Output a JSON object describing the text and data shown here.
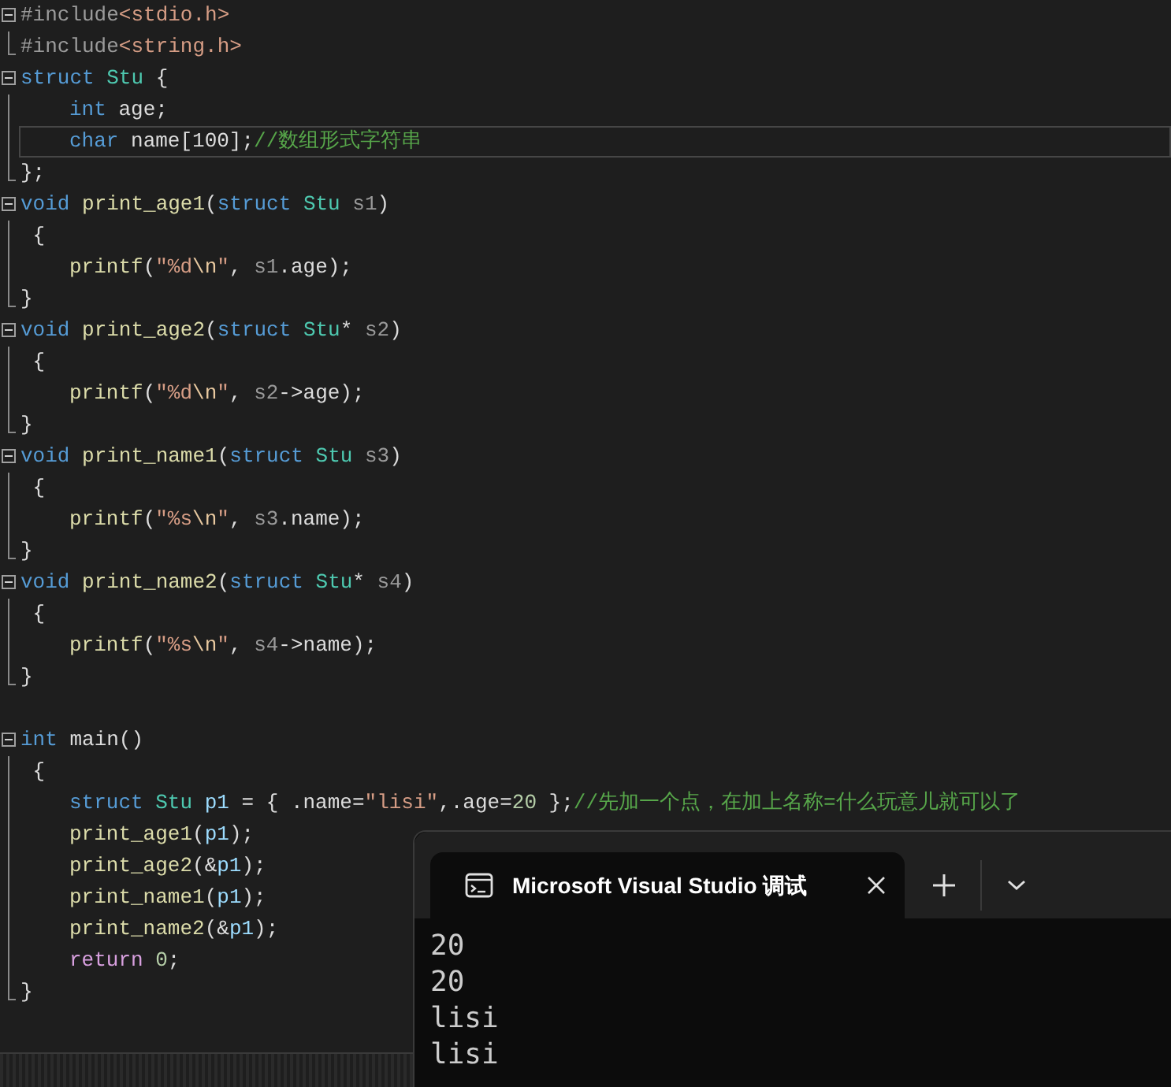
{
  "editor": {
    "items": [
      {
        "kind": "block",
        "expanded": true,
        "lines": [
          {
            "indented": false,
            "current": false,
            "tokens": [
              {
                "kind": "pre",
                "text": "#include"
              },
              {
                "kind": "str",
                "text": "<stdio.h>"
              }
            ]
          },
          {
            "indented": false,
            "current": false,
            "tokens": [
              {
                "kind": "pre",
                "text": "#include"
              },
              {
                "kind": "str",
                "text": "<string.h>"
              }
            ]
          }
        ]
      },
      {
        "kind": "block",
        "expanded": true,
        "lines": [
          {
            "indented": false,
            "current": false,
            "tokens": [
              {
                "kind": "kw",
                "text": "struct "
              },
              {
                "kind": "type",
                "text": "Stu"
              },
              {
                "kind": "txt",
                "text": " {"
              }
            ]
          },
          {
            "indented": true,
            "current": false,
            "tokens": [
              {
                "kind": "kw",
                "text": "int "
              },
              {
                "kind": "txt",
                "text": "age;"
              }
            ]
          },
          {
            "indented": true,
            "current": true,
            "tokens": [
              {
                "kind": "kw",
                "text": "char "
              },
              {
                "kind": "txt",
                "text": "name[100];"
              },
              {
                "kind": "cmt",
                "text": "//数组形式字符串"
              }
            ]
          },
          {
            "indented": false,
            "current": false,
            "tokens": [
              {
                "kind": "txt",
                "text": "};"
              }
            ]
          }
        ]
      },
      {
        "kind": "block",
        "expanded": true,
        "lines": [
          {
            "indented": false,
            "current": false,
            "tokens": [
              {
                "kind": "kw",
                "text": "void "
              },
              {
                "kind": "fn",
                "text": "print_age1"
              },
              {
                "kind": "txt",
                "text": "("
              },
              {
                "kind": "kw",
                "text": "struct "
              },
              {
                "kind": "type",
                "text": "Stu "
              },
              {
                "kind": "par",
                "text": "s1"
              },
              {
                "kind": "txt",
                "text": ")"
              }
            ]
          },
          {
            "indented": false,
            "current": false,
            "tokens": [
              {
                "kind": "txt",
                "text": " {"
              }
            ]
          },
          {
            "indented": true,
            "current": false,
            "tokens": [
              {
                "kind": "fn",
                "text": "printf"
              },
              {
                "kind": "txt",
                "text": "("
              },
              {
                "kind": "str",
                "text": "\"%d"
              },
              {
                "kind": "esc",
                "text": "\\n"
              },
              {
                "kind": "str",
                "text": "\""
              },
              {
                "kind": "txt",
                "text": ", "
              },
              {
                "kind": "par",
                "text": "s1"
              },
              {
                "kind": "txt",
                "text": ".age);"
              }
            ]
          },
          {
            "indented": false,
            "current": false,
            "tokens": [
              {
                "kind": "txt",
                "text": "}"
              }
            ]
          }
        ]
      },
      {
        "kind": "block",
        "expanded": true,
        "lines": [
          {
            "indented": false,
            "current": false,
            "tokens": [
              {
                "kind": "kw",
                "text": "void "
              },
              {
                "kind": "fn",
                "text": "print_age2"
              },
              {
                "kind": "txt",
                "text": "("
              },
              {
                "kind": "kw",
                "text": "struct "
              },
              {
                "kind": "type",
                "text": "Stu"
              },
              {
                "kind": "txt",
                "text": "* "
              },
              {
                "kind": "par",
                "text": "s2"
              },
              {
                "kind": "txt",
                "text": ")"
              }
            ]
          },
          {
            "indented": false,
            "current": false,
            "tokens": [
              {
                "kind": "txt",
                "text": " {"
              }
            ]
          },
          {
            "indented": true,
            "current": false,
            "tokens": [
              {
                "kind": "fn",
                "text": "printf"
              },
              {
                "kind": "txt",
                "text": "("
              },
              {
                "kind": "str",
                "text": "\"%d"
              },
              {
                "kind": "esc",
                "text": "\\n"
              },
              {
                "kind": "str",
                "text": "\""
              },
              {
                "kind": "txt",
                "text": ", "
              },
              {
                "kind": "par",
                "text": "s2"
              },
              {
                "kind": "txt",
                "text": "->age);"
              }
            ]
          },
          {
            "indented": false,
            "current": false,
            "tokens": [
              {
                "kind": "txt",
                "text": "}"
              }
            ]
          }
        ]
      },
      {
        "kind": "block",
        "expanded": true,
        "lines": [
          {
            "indented": false,
            "current": false,
            "tokens": [
              {
                "kind": "kw",
                "text": "void "
              },
              {
                "kind": "fn",
                "text": "print_name1"
              },
              {
                "kind": "txt",
                "text": "("
              },
              {
                "kind": "kw",
                "text": "struct "
              },
              {
                "kind": "type",
                "text": "Stu "
              },
              {
                "kind": "par",
                "text": "s3"
              },
              {
                "kind": "txt",
                "text": ")"
              }
            ]
          },
          {
            "indented": false,
            "current": false,
            "tokens": [
              {
                "kind": "txt",
                "text": " {"
              }
            ]
          },
          {
            "indented": true,
            "current": false,
            "tokens": [
              {
                "kind": "fn",
                "text": "printf"
              },
              {
                "kind": "txt",
                "text": "("
              },
              {
                "kind": "str",
                "text": "\"%s"
              },
              {
                "kind": "esc",
                "text": "\\n"
              },
              {
                "kind": "str",
                "text": "\""
              },
              {
                "kind": "txt",
                "text": ", "
              },
              {
                "kind": "par",
                "text": "s3"
              },
              {
                "kind": "txt",
                "text": ".name);"
              }
            ]
          },
          {
            "indented": false,
            "current": false,
            "tokens": [
              {
                "kind": "txt",
                "text": "}"
              }
            ]
          }
        ]
      },
      {
        "kind": "block",
        "expanded": true,
        "lines": [
          {
            "indented": false,
            "current": false,
            "tokens": [
              {
                "kind": "kw",
                "text": "void "
              },
              {
                "kind": "fn",
                "text": "print_name2"
              },
              {
                "kind": "txt",
                "text": "("
              },
              {
                "kind": "kw",
                "text": "struct "
              },
              {
                "kind": "type",
                "text": "Stu"
              },
              {
                "kind": "txt",
                "text": "* "
              },
              {
                "kind": "par",
                "text": "s4"
              },
              {
                "kind": "txt",
                "text": ")"
              }
            ]
          },
          {
            "indented": false,
            "current": false,
            "tokens": [
              {
                "kind": "txt",
                "text": " {"
              }
            ]
          },
          {
            "indented": true,
            "current": false,
            "tokens": [
              {
                "kind": "fn",
                "text": "printf"
              },
              {
                "kind": "txt",
                "text": "("
              },
              {
                "kind": "str",
                "text": "\"%s"
              },
              {
                "kind": "esc",
                "text": "\\n"
              },
              {
                "kind": "str",
                "text": "\""
              },
              {
                "kind": "txt",
                "text": ", "
              },
              {
                "kind": "par",
                "text": "s4"
              },
              {
                "kind": "txt",
                "text": "->name);"
              }
            ]
          },
          {
            "indented": false,
            "current": false,
            "tokens": [
              {
                "kind": "txt",
                "text": "}"
              }
            ]
          }
        ]
      },
      {
        "kind": "blank"
      },
      {
        "kind": "block",
        "expanded": true,
        "lines": [
          {
            "indented": false,
            "current": false,
            "tokens": [
              {
                "kind": "kw",
                "text": "int "
              },
              {
                "kind": "txt",
                "text": "main()"
              }
            ]
          },
          {
            "indented": false,
            "current": false,
            "tokens": [
              {
                "kind": "txt",
                "text": " {"
              }
            ]
          },
          {
            "indented": true,
            "current": false,
            "tokens": [
              {
                "kind": "kw",
                "text": "struct "
              },
              {
                "kind": "type",
                "text": "Stu "
              },
              {
                "kind": "var",
                "text": "p1"
              },
              {
                "kind": "txt",
                "text": " = { .name="
              },
              {
                "kind": "str",
                "text": "\"lisi\""
              },
              {
                "kind": "txt",
                "text": ",.age="
              },
              {
                "kind": "num",
                "text": "20"
              },
              {
                "kind": "txt",
                "text": " };"
              },
              {
                "kind": "cmt",
                "text": "//先加一个点，在加上名称=什么玩意儿就可以了"
              }
            ]
          },
          {
            "indented": true,
            "current": false,
            "tokens": [
              {
                "kind": "fn",
                "text": "print_age1"
              },
              {
                "kind": "txt",
                "text": "("
              },
              {
                "kind": "var",
                "text": "p1"
              },
              {
                "kind": "txt",
                "text": ");"
              }
            ]
          },
          {
            "indented": true,
            "current": false,
            "tokens": [
              {
                "kind": "fn",
                "text": "print_age2"
              },
              {
                "kind": "txt",
                "text": "(&"
              },
              {
                "kind": "var",
                "text": "p1"
              },
              {
                "kind": "txt",
                "text": ");"
              }
            ]
          },
          {
            "indented": true,
            "current": false,
            "tokens": [
              {
                "kind": "fn",
                "text": "print_name1"
              },
              {
                "kind": "txt",
                "text": "("
              },
              {
                "kind": "var",
                "text": "p1"
              },
              {
                "kind": "txt",
                "text": ");"
              }
            ]
          },
          {
            "indented": true,
            "current": false,
            "tokens": [
              {
                "kind": "fn",
                "text": "print_name2"
              },
              {
                "kind": "txt",
                "text": "(&"
              },
              {
                "kind": "var",
                "text": "p1"
              },
              {
                "kind": "txt",
                "text": ");"
              }
            ]
          },
          {
            "indented": true,
            "current": false,
            "tokens": [
              {
                "kind": "ctl",
                "text": "return "
              },
              {
                "kind": "num",
                "text": "0"
              },
              {
                "kind": "txt",
                "text": ";"
              }
            ]
          },
          {
            "indented": false,
            "current": false,
            "tokens": [
              {
                "kind": "txt",
                "text": "}"
              }
            ]
          }
        ]
      }
    ]
  },
  "terminal": {
    "tab": {
      "title": "Microsoft Visual Studio 调试",
      "selected": true
    },
    "output": [
      "20",
      "20",
      "lisi",
      "lisi"
    ]
  }
}
